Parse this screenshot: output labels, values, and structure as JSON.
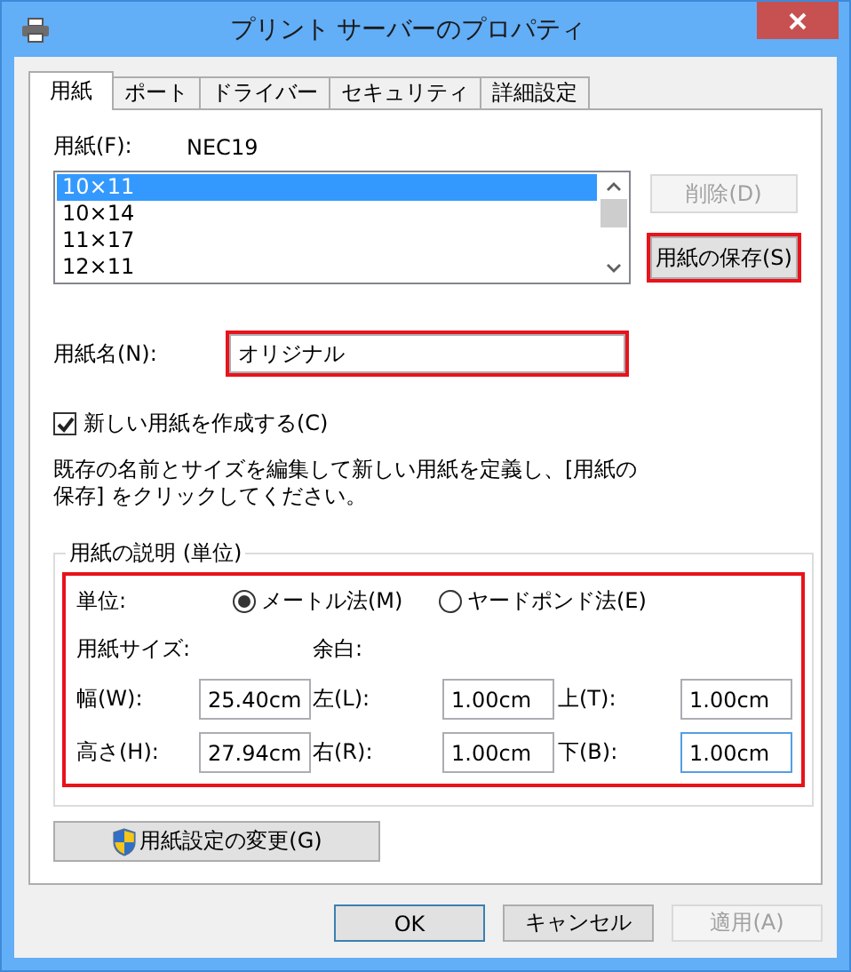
{
  "window": {
    "title": "プリント サーバーのプロパティ"
  },
  "tabs": [
    {
      "label": "用紙",
      "selected": true
    },
    {
      "label": "ポート",
      "selected": false
    },
    {
      "label": "ドライバー",
      "selected": false
    },
    {
      "label": "セキュリティ",
      "selected": false
    },
    {
      "label": "詳細設定",
      "selected": false
    }
  ],
  "paper": {
    "label": "用紙(F):",
    "current": "NEC19",
    "list": [
      {
        "label": "10×11",
        "selected": true
      },
      {
        "label": "10×14",
        "selected": false
      },
      {
        "label": "11×17",
        "selected": false
      },
      {
        "label": "12×11",
        "selected": false
      }
    ],
    "delete_button": {
      "label": "削除(D)",
      "disabled": true
    },
    "save_button": {
      "label": "用紙の保存(S)",
      "disabled": false,
      "highlighted": true
    }
  },
  "paper_name": {
    "label": "用紙名(N):",
    "value": "オリジナル",
    "highlighted": true
  },
  "create_new": {
    "label": "新しい用紙を作成する(C)",
    "checked": true
  },
  "instructions": [
    "既存の名前とサイズを編集して新しい用紙を定義し、[用紙の",
    "保存] をクリックしてください。"
  ],
  "description": {
    "title": "用紙の説明 (単位)",
    "highlighted": true,
    "units_label": "単位:",
    "units": [
      {
        "label": "メートル法(M)",
        "selected": true
      },
      {
        "label": "ヤードポンド法(E)",
        "selected": false
      }
    ],
    "size_label": "用紙サイズ:",
    "margin_label": "余白:",
    "fields": [
      {
        "label": "幅(W):",
        "value": "25.40cm",
        "focused": false
      },
      {
        "label": "左(L):",
        "value": "1.00cm",
        "focused": false
      },
      {
        "label": "上(T):",
        "value": "1.00cm",
        "focused": false
      },
      {
        "label": "高さ(H):",
        "value": "27.94cm",
        "focused": false
      },
      {
        "label": "右(R):",
        "value": "1.00cm",
        "focused": false
      },
      {
        "label": "下(B):",
        "value": "1.00cm",
        "focused": true
      }
    ]
  },
  "change_settings_button": {
    "label": "用紙設定の変更(G)"
  },
  "buttons": [
    {
      "label": "OK",
      "default": true,
      "disabled": false
    },
    {
      "label": "キャンセル",
      "default": false,
      "disabled": false
    },
    {
      "label": "適用(A)",
      "default": false,
      "disabled": true
    }
  ]
}
